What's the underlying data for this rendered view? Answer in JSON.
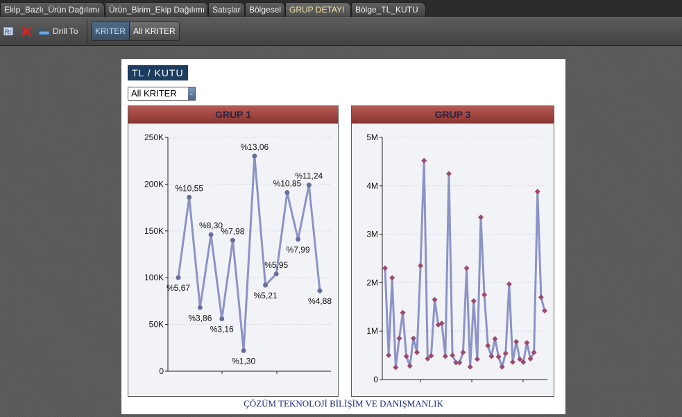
{
  "tabs": [
    {
      "label": "Ekip_Bazlı_Ürün Dağılımı",
      "active": false
    },
    {
      "label": "Ürün_Birim_Ekip Dağılımı",
      "active": false
    },
    {
      "label": "Satışlar",
      "active": false
    },
    {
      "label": "Bölgesel",
      "active": false
    },
    {
      "label": "GRUP DETAYI",
      "active": true
    },
    {
      "label": "Bölge_TL_KUTU",
      "active": false
    }
  ],
  "toolbar": {
    "drill_to_label": "Drill To",
    "kriter_label": "KRITER",
    "all_kriter_label": "All KRITER",
    "icons": [
      "filter-icon",
      "close-icon",
      "drill-to-icon"
    ]
  },
  "panel": {
    "title": "TL / KUTU",
    "dropdown_value": "All KRITER",
    "footer": "ÇÖZÜM TEKNOLOJİ BİLİŞİM VE DANIŞMANLIK"
  },
  "colors": {
    "line": "#8b93c7",
    "marker1": "#6a6f9a",
    "marker3": "#9c4a6e",
    "header": "#9a3f3b",
    "title_badge": "#1c3c60"
  },
  "chart_data": [
    {
      "type": "line",
      "title": "GRUP 1",
      "y_ticks": [
        "0",
        "50K",
        "100K",
        "150K",
        "200K",
        "250K"
      ],
      "ylim": [
        0,
        250000
      ],
      "grid": true,
      "marker": "circle",
      "series": [
        {
          "values": [
            100000,
            186000,
            68000,
            146000,
            56000,
            140000,
            22000,
            230000,
            92000,
            104000,
            191000,
            141000,
            199000,
            86000
          ],
          "labels": [
            "%5,67",
            "%10,55",
            "%3,86",
            "%8,30",
            "%3,16",
            "%7,98",
            "%1,30",
            "%13,06",
            "%5,21",
            "%5,95",
            "%10,85",
            "%7,99",
            "%11,24",
            "%4,88"
          ]
        }
      ]
    },
    {
      "type": "line",
      "title": "GRUP 3",
      "y_ticks": [
        "0",
        "1M",
        "2M",
        "3M",
        "4M",
        "5M"
      ],
      "ylim": [
        0,
        5000000
      ],
      "grid": true,
      "marker": "diamond",
      "series": [
        {
          "values": [
            2300000,
            500000,
            2100000,
            250000,
            850000,
            1380000,
            480000,
            280000,
            850000,
            560000,
            2350000,
            4520000,
            430000,
            490000,
            1650000,
            1130000,
            1160000,
            480000,
            4250000,
            500000,
            350000,
            350000,
            560000,
            2300000,
            260000,
            1620000,
            420000,
            3350000,
            1750000,
            700000,
            480000,
            840000,
            470000,
            260000,
            540000,
            1970000,
            360000,
            780000,
            420000,
            360000,
            760000,
            430000,
            560000,
            3880000,
            1700000,
            1420000
          ]
        }
      ]
    }
  ]
}
